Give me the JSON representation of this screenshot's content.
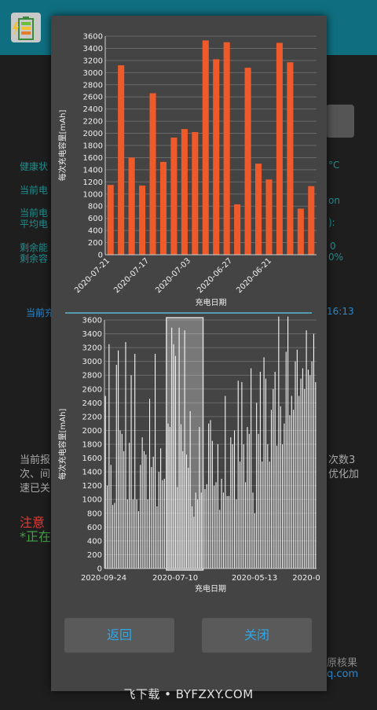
{
  "background": {
    "left_labels": [
      "健康状",
      "当前电",
      "当前电",
      "平均电",
      "剩余能",
      "剩余容"
    ],
    "right_labels": [
      "°C",
      "on",
      "):",
      "0",
      "0%"
    ],
    "current_label": "当前充",
    "time_right": "16:13",
    "desc_left": [
      "当前报",
      "次、间",
      "速已关"
    ],
    "desc_right": [
      "次数3",
      "优化加"
    ],
    "note_red": "注意",
    "note_green": "*正在",
    "footer_right": [
      "原核果",
      "q.com"
    ]
  },
  "watermark": "飞下载 • BYFZXY.COM",
  "buttons": {
    "back": "返回",
    "close": "关闭"
  },
  "chart_data": [
    {
      "type": "bar",
      "ylabel": "每次充电容量[mAh]",
      "xlabel": "充电日期",
      "ylim": [
        0,
        3600
      ],
      "yticks": [
        0,
        200,
        400,
        600,
        800,
        1000,
        1200,
        1400,
        1600,
        1800,
        2000,
        2200,
        2400,
        2600,
        2800,
        3000,
        3200,
        3400,
        3600
      ],
      "xtick_labels": [
        "2020-07-21",
        "2020-07-17",
        "2020-07-03",
        "2020-06-27",
        "2020-06-21"
      ],
      "values": [
        1150,
        3120,
        1600,
        1140,
        2660,
        1530,
        1930,
        2070,
        2020,
        3530,
        3220,
        3500,
        830,
        3080,
        1500,
        1240,
        3490,
        3170,
        760,
        1130
      ],
      "bar_color": "#ef5a2a"
    },
    {
      "type": "bar",
      "ylabel": "每次充电容量[mAh]",
      "xlabel": "充电日期",
      "ylim": [
        0,
        3600
      ],
      "yticks": [
        0,
        200,
        400,
        600,
        800,
        1000,
        1200,
        1400,
        1600,
        1800,
        2000,
        2200,
        2400,
        2600,
        2800,
        3000,
        3200,
        3400,
        3600
      ],
      "xtick_labels": [
        "2020-09-24",
        "2020-07-10",
        "2020-05-13",
        "2020-0"
      ],
      "values": [
        2500,
        1200,
        3250,
        1500,
        920,
        950,
        2950,
        3160,
        2000,
        1950,
        1700,
        3280,
        1000,
        1820,
        2800,
        1000,
        3110,
        1000,
        830,
        1500,
        1900,
        1700,
        1650,
        1000,
        2460,
        1470,
        1620,
        3110,
        900,
        1400,
        1740,
        1280,
        1300,
        1750,
        2100,
        2050,
        3490,
        3250,
        3080,
        1180,
        3490,
        2090,
        1700,
        3450,
        1650,
        1460,
        2280,
        900,
        750,
        1100,
        1000,
        2050,
        1100,
        1320,
        1150,
        1220,
        2100,
        2150,
        1850,
        1200,
        1250,
        1800,
        850,
        1300,
        1100,
        2500,
        1050,
        1050,
        1900,
        1800,
        2000,
        1000,
        2720,
        1550,
        2700,
        1800,
        1250,
        2050,
        1950,
        2900,
        1100,
        800,
        2400,
        1950,
        2850,
        1550,
        3060,
        2750,
        1800,
        1550,
        2300,
        2600,
        2850,
        1780,
        3650,
        2350,
        1800,
        2100,
        3140,
        3650,
        2220,
        2500,
        2300,
        3000,
        3170,
        2500,
        2750,
        2900,
        2600,
        3450,
        2880,
        2800,
        3000,
        3400,
        2700
      ],
      "selection_range": [
        0.292,
        0.465
      ],
      "bar_color": "#ffffff"
    }
  ]
}
